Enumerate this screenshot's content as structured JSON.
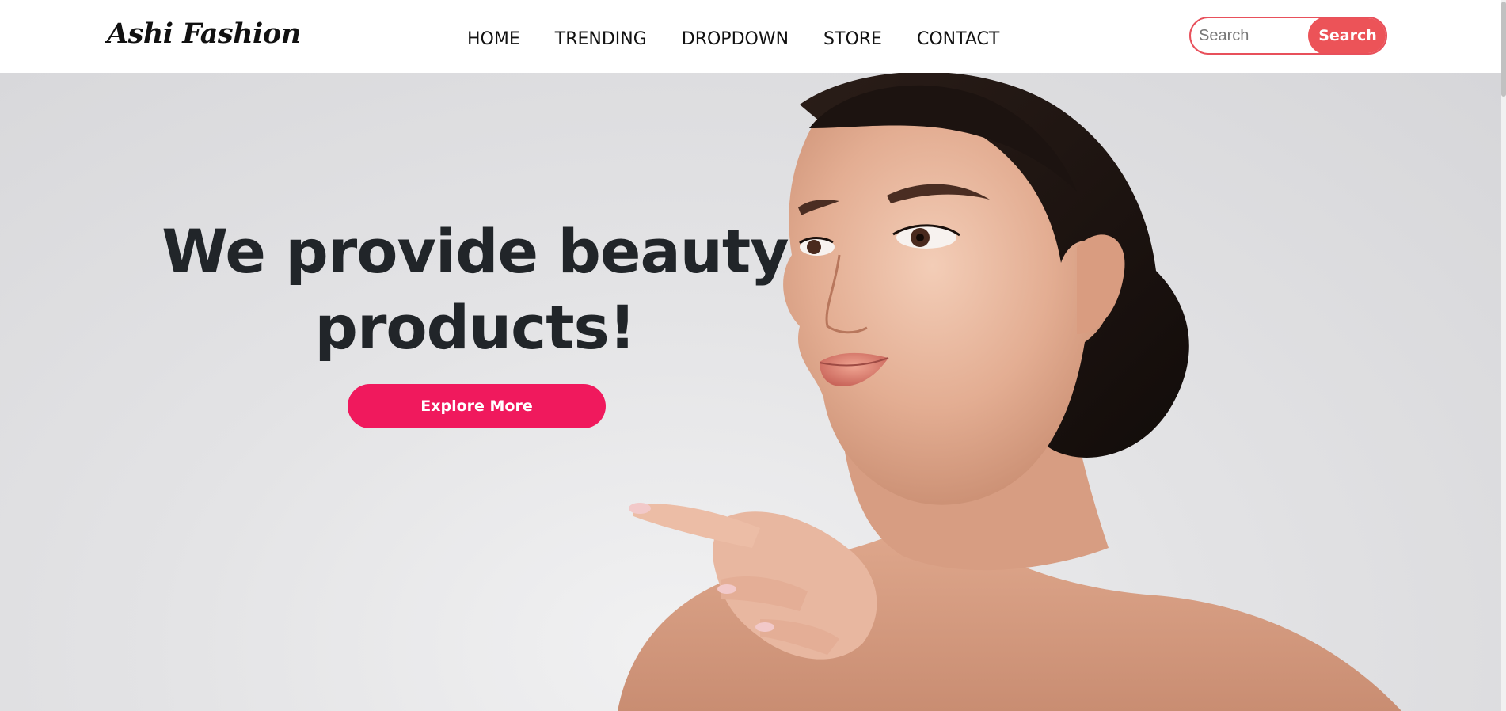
{
  "navbar": {
    "brand": "Ashi Fashion",
    "links": [
      {
        "label": "HOME"
      },
      {
        "label": "TRENDING"
      },
      {
        "label": "DROPDOWN"
      },
      {
        "label": "STORE"
      },
      {
        "label": "CONTACT"
      }
    ],
    "search": {
      "placeholder": "Search",
      "value": "",
      "button_label": "Search"
    }
  },
  "hero": {
    "title_line1": "We provide beauty",
    "title_line2": "products!",
    "cta_label": "Explore More",
    "image_subject": "woman-portrait"
  },
  "colors": {
    "accent": "#ec5358",
    "cta": "#f0195d",
    "heading": "#212529",
    "background": "#e3e3e5"
  }
}
